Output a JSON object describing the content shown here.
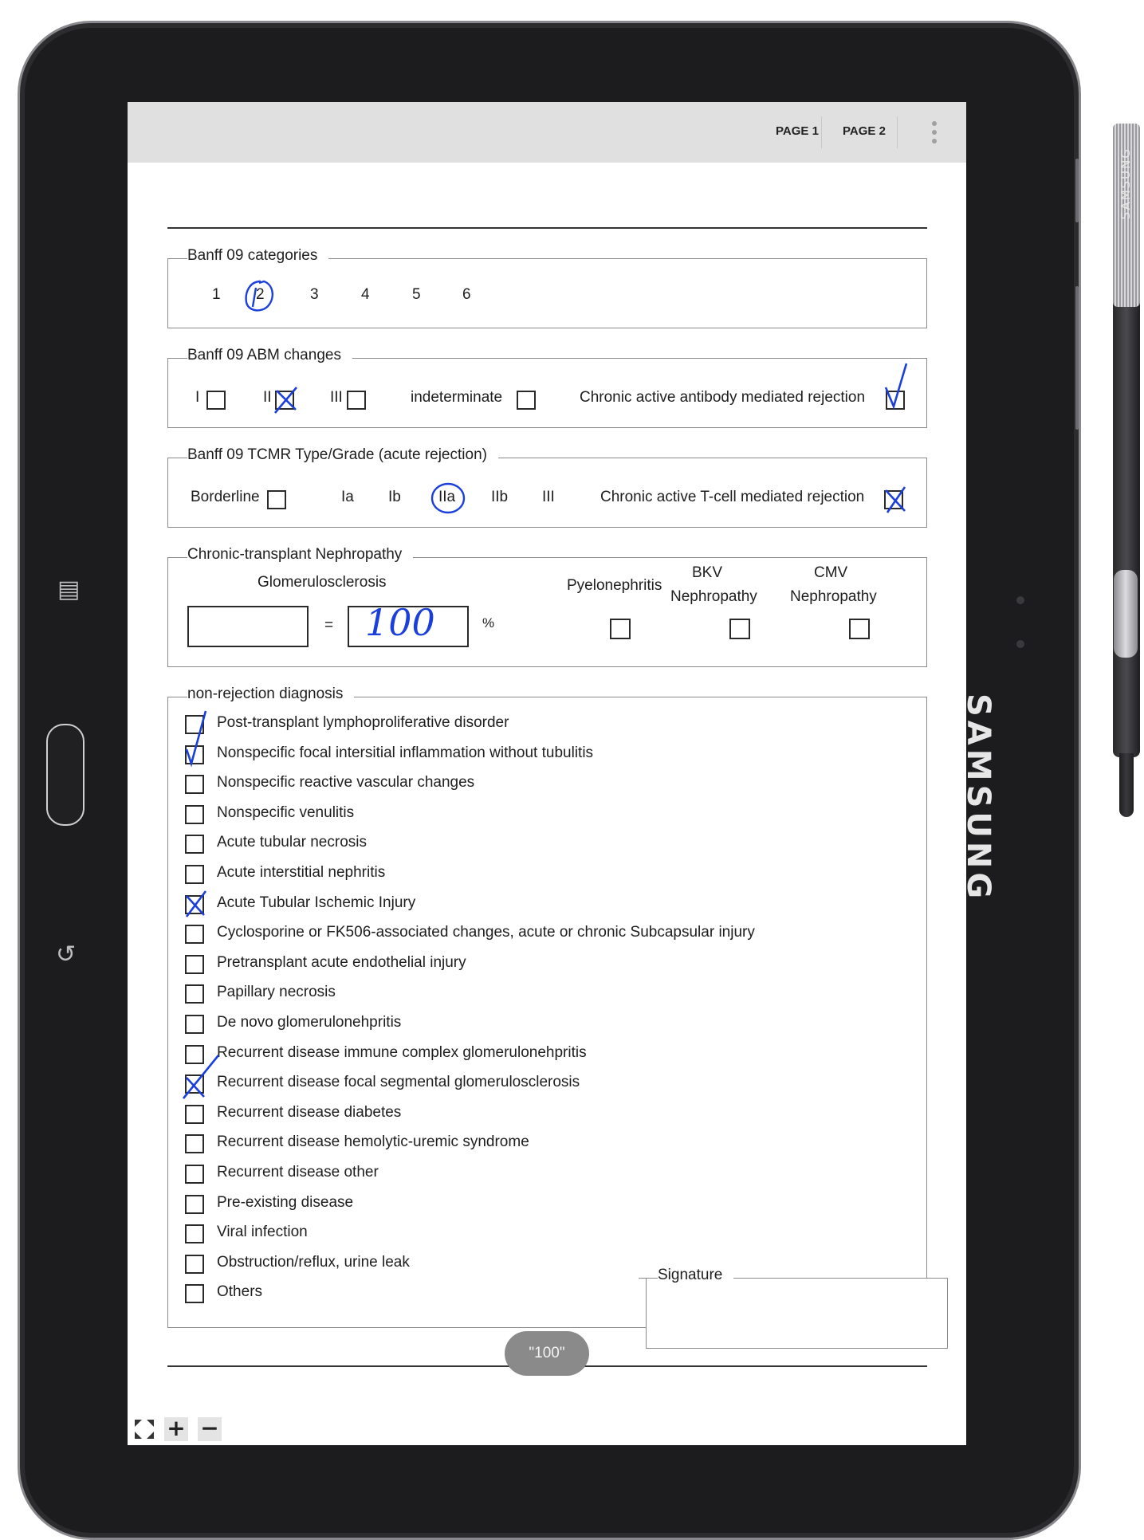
{
  "device": {
    "brand": "SAMSUNG",
    "pen_brand": "SAMSUNG"
  },
  "appbar": {
    "tabs": [
      "PAGE 1",
      "PAGE 2"
    ]
  },
  "form": {
    "categories": {
      "legend": "Banff 09 categories",
      "options": [
        "1",
        "2",
        "3",
        "4",
        "5",
        "6"
      ],
      "selected": "2"
    },
    "abm": {
      "legend": "Banff 09 ABM changes",
      "options": [
        {
          "label": "I",
          "state": "empty"
        },
        {
          "label": "II",
          "state": "cross"
        },
        {
          "label": "III",
          "state": "empty"
        },
        {
          "label": "indeterminate",
          "state": "empty"
        },
        {
          "label": "Chronic active antibody mediated rejection",
          "state": "check"
        }
      ]
    },
    "tcmr": {
      "legend": "Banff 09 TCMR Type/Grade (acute rejection)",
      "borderline": "Borderline",
      "grades": [
        "Ia",
        "Ib",
        "IIa",
        "IIb",
        "III"
      ],
      "selected_grade": "IIa",
      "chronic": "Chronic active T-cell mediated rejection",
      "chronic_state": "cross"
    },
    "nephropathy": {
      "legend": "Chronic-transplant Nephropathy",
      "glomerulosclerosis": "Glomerulosclerosis",
      "equals": "=",
      "value": "100",
      "unit": "%",
      "pyelonephritis": "Pyelonephritis",
      "bkv_line1": "BKV",
      "bkv_line2": "Nephropathy",
      "cmv_line1": "CMV",
      "cmv_line2": "Nephropathy"
    },
    "nonrejection": {
      "legend": "non-rejection diagnosis",
      "items": [
        {
          "label": "Post-transplant lymphoproliferative disorder",
          "state": "empty"
        },
        {
          "label": "Nonspecific focal intersitial inflammation without tubulitis",
          "state": "check"
        },
        {
          "label": "Nonspecific reactive vascular changes",
          "state": "empty"
        },
        {
          "label": "Nonspecific venulitis",
          "state": "empty"
        },
        {
          "label": "Acute tubular necrosis",
          "state": "empty"
        },
        {
          "label": "Acute interstitial nephritis",
          "state": "empty"
        },
        {
          "label": "Acute Tubular Ischemic Injury",
          "state": "cross"
        },
        {
          "label": "Cyclosporine or FK506-associated changes, acute or chronic Subcapsular injury",
          "state": "empty"
        },
        {
          "label": "Pretransplant acute endothelial injury",
          "state": "empty"
        },
        {
          "label": "Papillary necrosis",
          "state": "empty"
        },
        {
          "label": "De novo glomerulonehpritis",
          "state": "empty"
        },
        {
          "label": "Recurrent disease immune complex glomerulonehpritis",
          "state": "empty"
        },
        {
          "label": "Recurrent disease focal segmental glomerulosclerosis",
          "state": "cross"
        },
        {
          "label": "Recurrent disease diabetes",
          "state": "empty"
        },
        {
          "label": "Recurrent disease hemolytic-uremic syndrome",
          "state": "empty"
        },
        {
          "label": "Recurrent disease other",
          "state": "empty"
        },
        {
          "label": "Pre-existing disease",
          "state": "empty"
        },
        {
          "label": "Viral infection",
          "state": "empty"
        },
        {
          "label": "Obstruction/reflux, urine leak",
          "state": "empty"
        },
        {
          "label": "Others",
          "state": "empty"
        }
      ]
    },
    "signature": {
      "legend": "Signature"
    }
  },
  "recognized_value_toast": "\"100\"",
  "colors": {
    "ink": "#1a3fdc",
    "appbar": "#e0e0e0",
    "bezel": "#1c1c1e"
  },
  "icons": {
    "fullscreen": "fullscreen-icon",
    "zoom_in": "plus-icon",
    "zoom_out": "minus-icon",
    "menu": "more-vert-icon"
  }
}
